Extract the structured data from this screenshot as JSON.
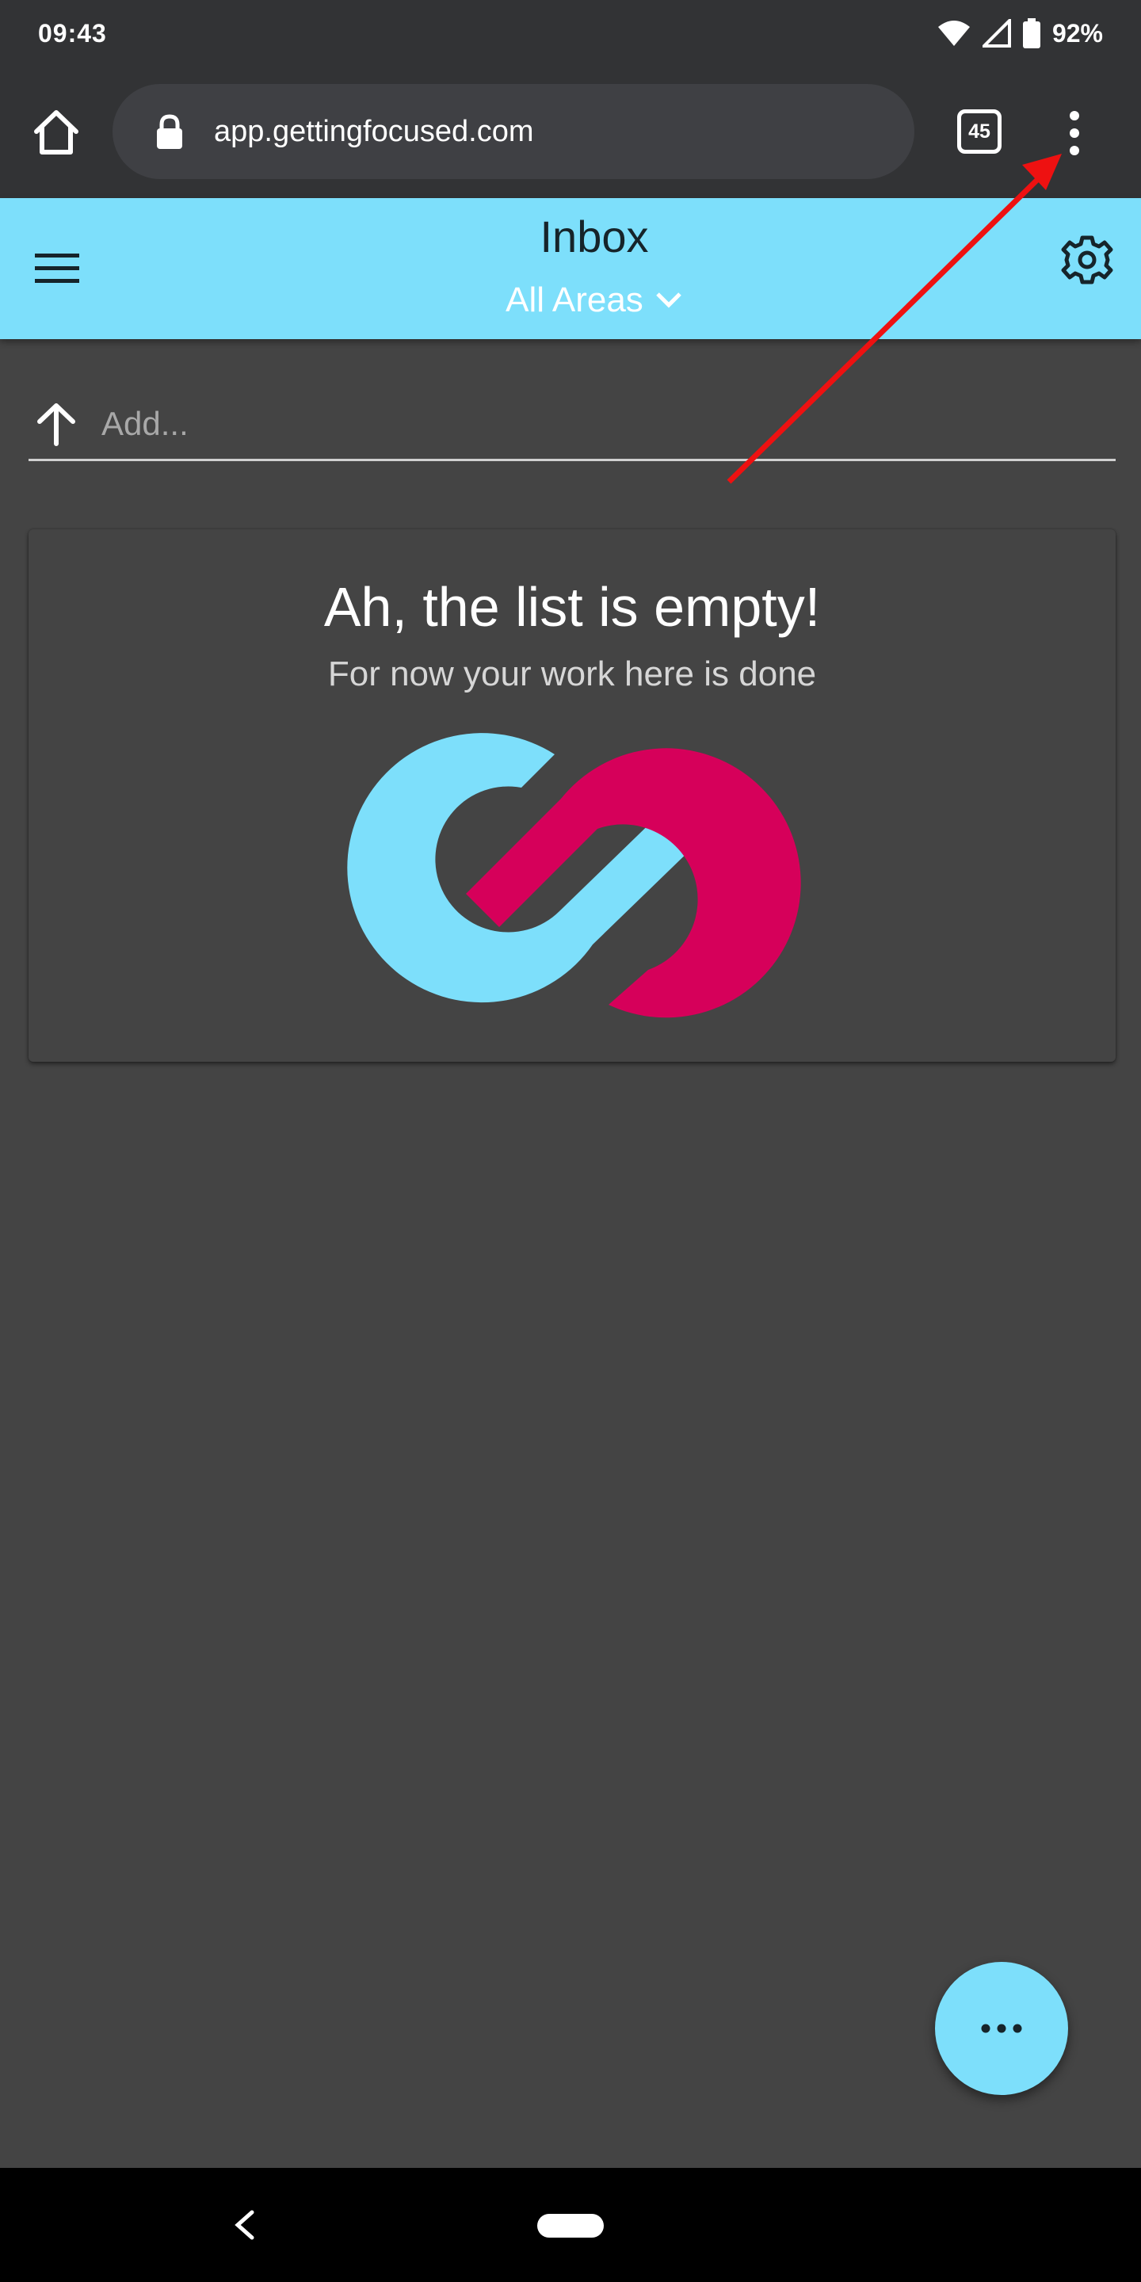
{
  "status_bar": {
    "time": "09:43",
    "battery": "92%",
    "icons": [
      "wifi-icon",
      "signal-icon",
      "battery-icon"
    ]
  },
  "browser": {
    "url": "app.gettingfocused.com",
    "tab_count": "45",
    "icons": [
      "home-icon",
      "lock-icon",
      "more-vert-icon"
    ]
  },
  "header": {
    "title": "Inbox",
    "area_filter": "All Areas",
    "icons": [
      "menu-icon",
      "chevron-down-icon",
      "gear-icon"
    ],
    "color": "#7ddffb"
  },
  "add_task": {
    "placeholder": "Add...",
    "value": ""
  },
  "empty_state": {
    "title": "Ah, the list is empty!",
    "subtitle": "For now your work here is done",
    "logo_colors": [
      "#7ddffb",
      "#d6005a"
    ]
  },
  "annotation": {
    "type": "arrow",
    "color": "#ee1111"
  },
  "fab": {
    "icon": "more-horiz-icon"
  },
  "colors": {
    "background": "#444444",
    "accent": "#7ddffb",
    "brand_pink": "#d6005a"
  }
}
